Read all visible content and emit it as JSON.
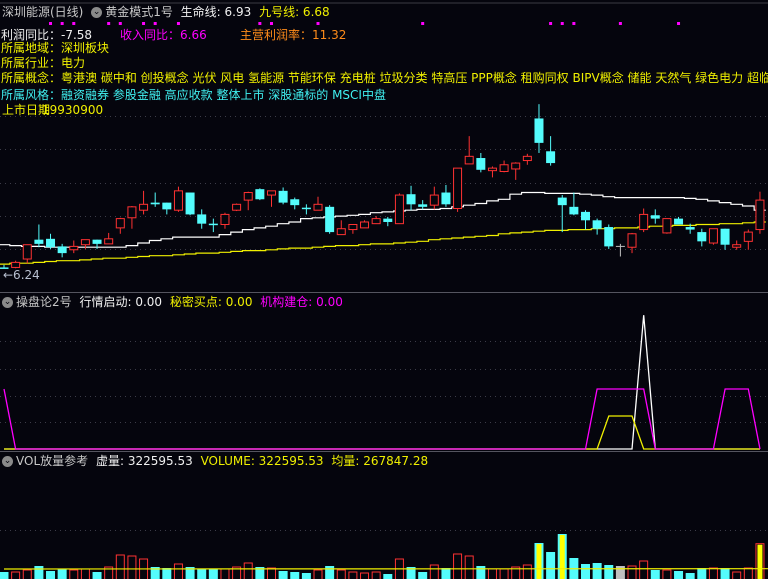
{
  "header": {
    "title": "深圳能源(日线)",
    "indicator_name": "黄金模式1号",
    "life_line_label": "生命线: 6.93",
    "nine_line_label": "九号线: 6.68",
    "profit_yoy": "利润同比：-7.58",
    "revenue_yoy": "收入同比：6.66",
    "main_margin": "主营利润率：11.32",
    "region": "所属地域：深圳板块",
    "industry": "所属行业：电力",
    "concepts": "所属概念：粤港澳 碳中和 创投概念 光伏 风电 氢能源 节能环保 充电桩 垃圾分类 特高压 PPP概念 租购同权 BIPV概念 储能 天然气 绿色电力 超临",
    "style": "所属风格：融资融券 参股金融 高应收款 整体上市 深股通标的 MSCI中盘",
    "listing_label": "上市日期",
    "listing_value": "19930900",
    "low_marker": "←6.24"
  },
  "indicator_panel": {
    "name": "操盘论2号",
    "start_label": "行情启动: 0.00",
    "buy_label": "秘密买点: 0.00",
    "build_label": "机构建仓: 0.00"
  },
  "volume_panel": {
    "name": "VOL放量参考",
    "virtual_label": "虚量: 322595.53",
    "volume_label": "VOLUME: 322595.53",
    "avg_label": "均量: 267847.28"
  },
  "colors": {
    "up": "#ff3232",
    "down": "#54fcfc",
    "flat": "#c0c0c0",
    "life_line": "#ffffff",
    "nine_line": "#f0f000",
    "marker": "#ff00ff",
    "background": "#05050d"
  },
  "chart_data": [
    {
      "type": "candlestick",
      "title": "深圳能源(日线)",
      "ylim": [
        5.97,
        9.38
      ],
      "grid": true,
      "ohlc": [
        [
          6.25,
          6.28,
          6.24,
          6.24
        ],
        [
          6.25,
          6.33,
          6.24,
          6.31
        ],
        [
          6.35,
          6.52,
          6.3,
          6.52
        ],
        [
          6.58,
          6.76,
          6.49,
          6.53
        ],
        [
          6.59,
          6.65,
          6.47,
          6.49
        ],
        [
          6.5,
          6.53,
          6.37,
          6.42
        ],
        [
          6.46,
          6.57,
          6.42,
          6.5
        ],
        [
          6.52,
          6.58,
          6.47,
          6.58
        ],
        [
          6.58,
          6.58,
          6.47,
          6.53
        ],
        [
          6.53,
          6.66,
          6.53,
          6.59
        ],
        [
          6.72,
          6.84,
          6.65,
          6.83
        ],
        [
          6.84,
          6.98,
          6.71,
          6.97
        ],
        [
          6.93,
          7.16,
          6.88,
          7.0
        ],
        [
          7.02,
          7.14,
          6.97,
          7.0
        ],
        [
          7.02,
          7.02,
          6.88,
          6.94
        ],
        [
          6.93,
          7.21,
          6.91,
          7.16
        ],
        [
          7.14,
          7.14,
          6.87,
          6.88
        ],
        [
          6.88,
          6.94,
          6.71,
          6.77
        ],
        [
          6.77,
          6.83,
          6.67,
          6.76
        ],
        [
          6.76,
          6.9,
          6.71,
          6.88
        ],
        [
          6.93,
          7.01,
          6.92,
          7.0
        ],
        [
          7.05,
          7.15,
          6.93,
          7.14
        ],
        [
          7.18,
          7.19,
          7.05,
          7.06
        ],
        [
          7.11,
          7.16,
          6.97,
          7.16
        ],
        [
          7.16,
          7.2,
          7.0,
          7.02
        ],
        [
          7.06,
          7.08,
          6.94,
          6.99
        ],
        [
          6.96,
          7.0,
          6.88,
          6.95
        ],
        [
          6.93,
          7.09,
          6.93,
          7.0
        ],
        [
          6.97,
          6.99,
          6.65,
          6.67
        ],
        [
          6.64,
          6.81,
          6.64,
          6.71
        ],
        [
          6.7,
          6.76,
          6.65,
          6.76
        ],
        [
          6.72,
          6.81,
          6.72,
          6.79
        ],
        [
          6.77,
          6.86,
          6.77,
          6.83
        ],
        [
          6.83,
          6.85,
          6.74,
          6.79
        ],
        [
          6.77,
          7.13,
          6.77,
          7.11
        ],
        [
          7.12,
          7.22,
          6.93,
          7.0
        ],
        [
          7.0,
          7.05,
          6.94,
          6.97
        ],
        [
          6.99,
          7.21,
          6.94,
          7.11
        ],
        [
          7.14,
          7.23,
          6.97,
          7.0
        ],
        [
          6.95,
          7.43,
          6.91,
          7.43
        ],
        [
          7.48,
          7.81,
          7.48,
          7.57
        ],
        [
          7.55,
          7.61,
          7.38,
          7.41
        ],
        [
          7.4,
          7.45,
          7.32,
          7.43
        ],
        [
          7.39,
          7.52,
          7.38,
          7.47
        ],
        [
          7.42,
          7.5,
          7.29,
          7.49
        ],
        [
          7.52,
          7.6,
          7.47,
          7.57
        ],
        [
          8.02,
          8.19,
          7.61,
          7.73
        ],
        [
          7.63,
          7.81,
          7.46,
          7.49
        ],
        [
          7.08,
          7.11,
          6.67,
          6.99
        ],
        [
          6.97,
          7.14,
          6.87,
          6.88
        ],
        [
          6.91,
          6.93,
          6.7,
          6.81
        ],
        [
          6.81,
          6.83,
          6.64,
          6.71
        ],
        [
          6.73,
          6.76,
          6.47,
          6.5
        ],
        [
          6.5,
          6.53,
          6.38,
          6.5
        ],
        [
          6.49,
          6.66,
          6.42,
          6.65
        ],
        [
          6.7,
          6.95,
          6.67,
          6.88
        ],
        [
          6.87,
          6.94,
          6.77,
          6.83
        ],
        [
          6.66,
          6.83,
          6.65,
          6.83
        ],
        [
          6.83,
          6.85,
          6.76,
          6.76
        ],
        [
          6.73,
          6.77,
          6.65,
          6.7
        ],
        [
          6.67,
          6.71,
          6.5,
          6.56
        ],
        [
          6.54,
          6.71,
          6.52,
          6.71
        ],
        [
          6.71,
          6.71,
          6.46,
          6.52
        ],
        [
          6.49,
          6.57,
          6.46,
          6.52
        ],
        [
          6.56,
          6.7,
          6.46,
          6.67
        ],
        [
          6.7,
          7.15,
          6.65,
          7.05
        ]
      ],
      "series": [
        {
          "name": "生命线",
          "color": "#ffffff",
          "values": [
            6.52,
            6.51,
            6.5,
            6.5,
            6.49,
            6.49,
            6.49,
            6.49,
            6.49,
            6.49,
            6.49,
            6.51,
            6.54,
            6.57,
            6.59,
            6.61,
            6.61,
            6.61,
            6.61,
            6.64,
            6.67,
            6.7,
            6.72,
            6.74,
            6.77,
            6.79,
            6.83,
            6.84,
            6.85,
            6.86,
            6.87,
            6.88,
            6.9,
            6.91,
            6.92,
            6.93,
            6.94,
            6.94,
            6.95,
            6.97,
            6.99,
            7.01,
            7.04,
            7.06,
            7.12,
            7.14,
            7.14,
            7.13,
            7.13,
            7.13,
            7.12,
            7.11,
            7.09,
            7.08,
            7.08,
            7.08,
            7.08,
            7.08,
            7.08,
            7.07,
            7.06,
            7.04,
            7.02,
            7.0,
            6.98,
            6.93
          ]
        },
        {
          "name": "九号线",
          "color": "#f0f000",
          "values": [
            6.29,
            6.3,
            6.3,
            6.31,
            6.32,
            6.33,
            6.33,
            6.34,
            6.35,
            6.36,
            6.36,
            6.37,
            6.38,
            6.39,
            6.39,
            6.4,
            6.41,
            6.42,
            6.42,
            6.43,
            6.44,
            6.45,
            6.45,
            6.46,
            6.47,
            6.48,
            6.48,
            6.49,
            6.5,
            6.51,
            6.51,
            6.52,
            6.53,
            6.53,
            6.54,
            6.55,
            6.56,
            6.58,
            6.59,
            6.6,
            6.61,
            6.62,
            6.63,
            6.65,
            6.66,
            6.67,
            6.68,
            6.69,
            6.69,
            6.7,
            6.7,
            6.71,
            6.71,
            6.72,
            6.72,
            6.73,
            6.74,
            6.74,
            6.75,
            6.75,
            6.76,
            6.76,
            6.77,
            6.77,
            6.78,
            6.79
          ]
        }
      ],
      "marker_indices": [
        4,
        5,
        6,
        9,
        10,
        12,
        13,
        15,
        22,
        23,
        27,
        36,
        47,
        48,
        49,
        53,
        58
      ],
      "annotations": [
        "←6.24"
      ]
    },
    {
      "type": "line",
      "title": "操盘论2号",
      "ylim": [
        0,
        240
      ],
      "series": [
        {
          "name": "行情启动",
          "color": "#ffffff",
          "values": [
            0,
            0,
            0,
            0,
            0,
            0,
            0,
            0,
            0,
            0,
            0,
            0,
            0,
            0,
            0,
            0,
            0,
            0,
            0,
            0,
            0,
            0,
            0,
            0,
            0,
            0,
            0,
            0,
            0,
            0,
            0,
            0,
            0,
            0,
            0,
            0,
            0,
            0,
            0,
            0,
            0,
            0,
            0,
            0,
            0,
            0,
            0,
            0,
            0,
            0,
            0,
            0,
            0,
            0,
            0,
            223,
            0,
            0,
            0,
            0,
            0,
            0,
            0,
            0,
            0,
            0
          ]
        },
        {
          "name": "秘密买点",
          "color": "#f0f000",
          "values": [
            0,
            0,
            0,
            0,
            0,
            0,
            0,
            0,
            0,
            0,
            0,
            0,
            0,
            0,
            0,
            0,
            0,
            0,
            0,
            0,
            0,
            0,
            0,
            0,
            0,
            0,
            0,
            0,
            0,
            0,
            0,
            0,
            0,
            0,
            0,
            0,
            0,
            0,
            0,
            0,
            0,
            0,
            0,
            0,
            0,
            0,
            0,
            0,
            0,
            0,
            0,
            0,
            55,
            55,
            55,
            0,
            0,
            0,
            0,
            0,
            0,
            0,
            0,
            0,
            0,
            0
          ]
        },
        {
          "name": "机构建仓",
          "color": "#ff00ff",
          "values": [
            100,
            0,
            0,
            0,
            0,
            0,
            0,
            0,
            0,
            0,
            0,
            0,
            0,
            0,
            0,
            0,
            0,
            0,
            0,
            0,
            0,
            0,
            0,
            0,
            0,
            0,
            0,
            0,
            0,
            0,
            0,
            0,
            0,
            0,
            0,
            0,
            0,
            0,
            0,
            0,
            0,
            0,
            0,
            0,
            0,
            0,
            0,
            0,
            0,
            0,
            0,
            100,
            100,
            100,
            100,
            100,
            0,
            0,
            0,
            0,
            0,
            0,
            100,
            100,
            100,
            0
          ]
        }
      ]
    },
    {
      "type": "bar",
      "title": "VOL放量参考",
      "ylim": [
        245280,
        484000
      ],
      "values": [
        260610,
        260610,
        264990,
        273750,
        262800,
        267180,
        264990,
        267180,
        260610,
        271560,
        297840,
        295650,
        289080,
        271560,
        269370,
        278130,
        271560,
        267180,
        267180,
        267180,
        271560,
        280320,
        271560,
        269370,
        262800,
        260610,
        258420,
        264990,
        273750,
        264990,
        260610,
        258420,
        260610,
        256230,
        289080,
        271560,
        260610,
        275940,
        269370,
        300030,
        295650,
        273750,
        267180,
        267180,
        271560,
        275940,
        324120,
        304410,
        343830,
        291270,
        278130,
        280320,
        275940,
        273750,
        273750,
        284700,
        264990,
        264990,
        262800,
        258420,
        269370,
        269370,
        269370,
        260610,
        269370,
        322596
      ],
      "highlight_indices": [
        46,
        48,
        65
      ],
      "avg_series": {
        "name": "均量",
        "color": "#f0f000",
        "start": 267180,
        "end": 267847
      }
    }
  ]
}
